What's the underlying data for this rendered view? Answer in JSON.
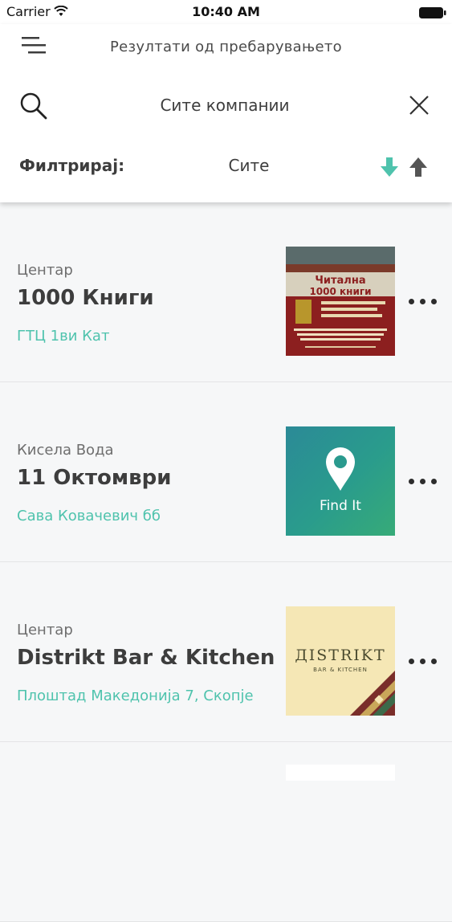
{
  "status_bar": {
    "carrier": "Carrier",
    "time": "10:40 AM"
  },
  "header": {
    "title": "Резултати од пребарувањето",
    "menu_icon": "hamburger-menu-icon",
    "search": {
      "value": "Сите компании",
      "search_icon": "search-icon",
      "clear_icon": "close-icon"
    },
    "filter": {
      "label": "Филтрирај:",
      "value": "Сите",
      "sort_desc_color": "#4fc3ad",
      "sort_asc_color": "#555555"
    }
  },
  "colors": {
    "accent": "#4fc3ad",
    "text": "#3d3d3d",
    "background": "#f6f7f8"
  },
  "results": [
    {
      "area": "Центар",
      "name": "1000 Книги",
      "address": "ГТЦ 1ви Кат",
      "thumbnail": "bookstore-poster-image",
      "thumb_text_1": "Читална",
      "thumb_text_2": "1000 книги"
    },
    {
      "area": "Кисела Вода",
      "name": "11 Октомври",
      "address": "Сава Ковачевич бб",
      "thumbnail": "find-it-logo-image",
      "thumb_text": "Find It"
    },
    {
      "area": "Центар",
      "name": "Distrikt Bar & Kitchen",
      "address": "Плоштад Македонија 7, Скопје",
      "thumbnail": "distrikt-logo-image",
      "thumb_text": "ДISTRIKT",
      "thumb_subtext": "BAR & KITCHEN"
    }
  ]
}
